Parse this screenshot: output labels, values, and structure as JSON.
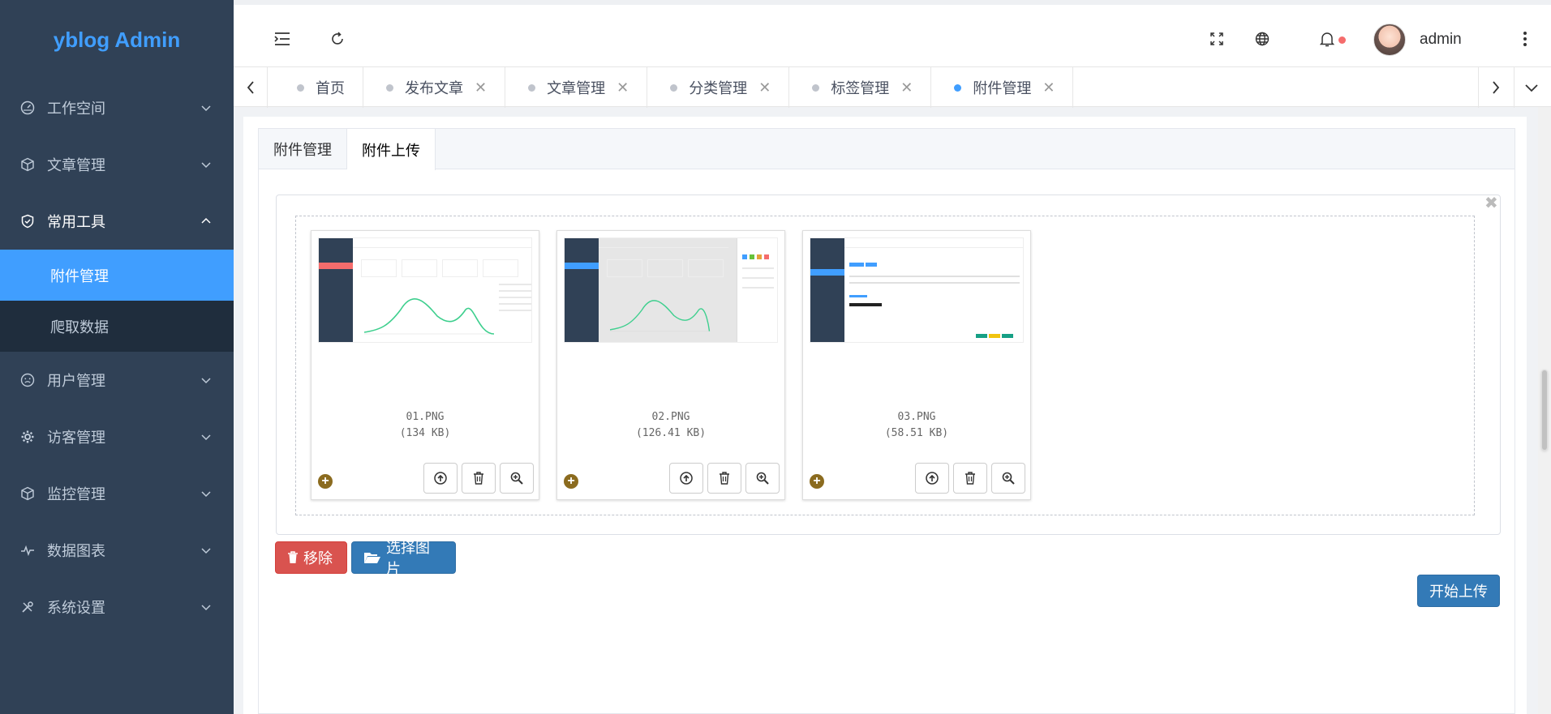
{
  "app": {
    "title": "yblog Admin"
  },
  "sidebar": {
    "items": [
      {
        "label": "工作空间",
        "icon": "dashboard-icon"
      },
      {
        "label": "文章管理",
        "icon": "cube-icon"
      },
      {
        "label": "常用工具",
        "icon": "shield-check-icon",
        "open": true,
        "children": [
          {
            "label": "附件管理",
            "active": true
          },
          {
            "label": "爬取数据"
          }
        ]
      },
      {
        "label": "用户管理",
        "icon": "smile-icon"
      },
      {
        "label": "访客管理",
        "icon": "gear-icon"
      },
      {
        "label": "监控管理",
        "icon": "cube-icon"
      },
      {
        "label": "数据图表",
        "icon": "pulse-icon"
      },
      {
        "label": "系统设置",
        "icon": "tools-icon"
      }
    ]
  },
  "header": {
    "username": "admin"
  },
  "tabs": [
    {
      "label": "首页",
      "closable": false
    },
    {
      "label": "发布文章",
      "closable": true
    },
    {
      "label": "文章管理",
      "closable": true
    },
    {
      "label": "分类管理",
      "closable": true
    },
    {
      "label": "标签管理",
      "closable": true
    },
    {
      "label": "附件管理",
      "closable": true,
      "active": true
    }
  ],
  "card": {
    "tabs": [
      {
        "label": "附件管理"
      },
      {
        "label": "附件上传",
        "active": true
      }
    ]
  },
  "files": [
    {
      "name": "01.PNG",
      "size": "(134 KB)"
    },
    {
      "name": "02.PNG",
      "size": "(126.41 KB)"
    },
    {
      "name": "03.PNG",
      "size": "(58.51 KB)"
    }
  ],
  "actions": {
    "remove_label": "移除",
    "select_label": "选择图片",
    "upload_label": "开始上传"
  },
  "colors": {
    "accent": "#409eff",
    "sidebar_bg": "#304156",
    "danger": "#d9534f",
    "primary": "#337ab7"
  }
}
